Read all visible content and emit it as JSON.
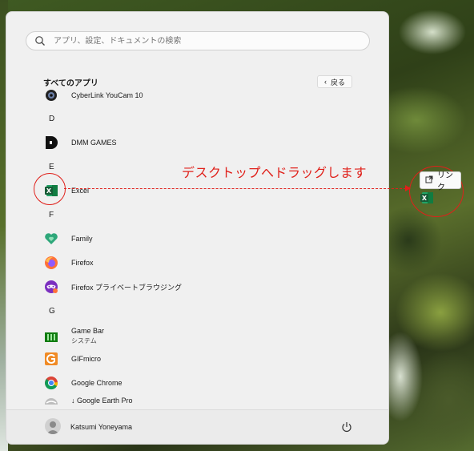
{
  "search": {
    "placeholder": "アプリ、設定、ドキュメントの検索"
  },
  "all_apps": {
    "title": "すべてのアプリ",
    "back_label": "戻る"
  },
  "apps": [
    {
      "name": "CyberLink YouCam 10"
    },
    {
      "letter": "D"
    },
    {
      "name": "DMM GAMES"
    },
    {
      "letter": "E"
    },
    {
      "name": "Excel"
    },
    {
      "letter": "F"
    },
    {
      "name": "Family"
    },
    {
      "name": "Firefox"
    },
    {
      "name": "Firefox プライベートブラウジング"
    },
    {
      "letter": "G"
    },
    {
      "name": "Game Bar",
      "sub": "システム"
    },
    {
      "name": "GIFmicro"
    },
    {
      "name": "Google Chrome"
    },
    {
      "name": "↓ Google Earth Pro"
    }
  ],
  "user": {
    "name": "Katsumi Yoneyama"
  },
  "annotation": {
    "text": "デスクトップへドラッグします"
  },
  "drag_tooltip": {
    "label": "リンク"
  },
  "colors": {
    "annotation": "#e0201a",
    "excel": "#1d6f42",
    "chrome_red": "#db4437"
  }
}
